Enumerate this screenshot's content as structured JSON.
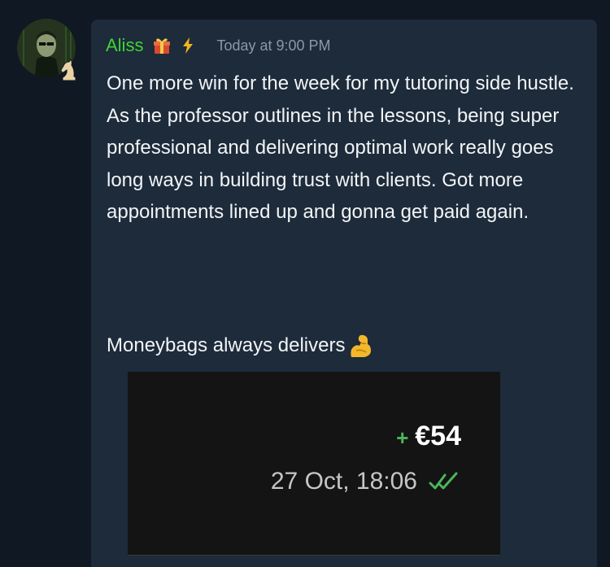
{
  "message": {
    "author": "Aliss",
    "timestamp": "Today at 9:00 PM",
    "body": "One more win for the week for my tutoring side hustle. As the professor outlines in the lessons, being super professional and delivering optimal work really goes long ways in building trust with clients. Got more appointments lined up and gonna get paid again.",
    "closing": "Moneybags always delivers",
    "badges": [
      "gift-icon",
      "lightning-icon"
    ],
    "closing_emoji": "flexed-biceps-icon"
  },
  "attachment": {
    "amount_sign": "+",
    "amount": "€54",
    "date": "27 Oct, 18:06",
    "status_icon": "double-check-icon"
  },
  "colors": {
    "background": "#0f1823",
    "bubble": "#1d2b3b",
    "username": "#3fd431",
    "timestamp": "#8c98a6",
    "text": "#f2f4f6",
    "positive": "#4cb65a"
  }
}
